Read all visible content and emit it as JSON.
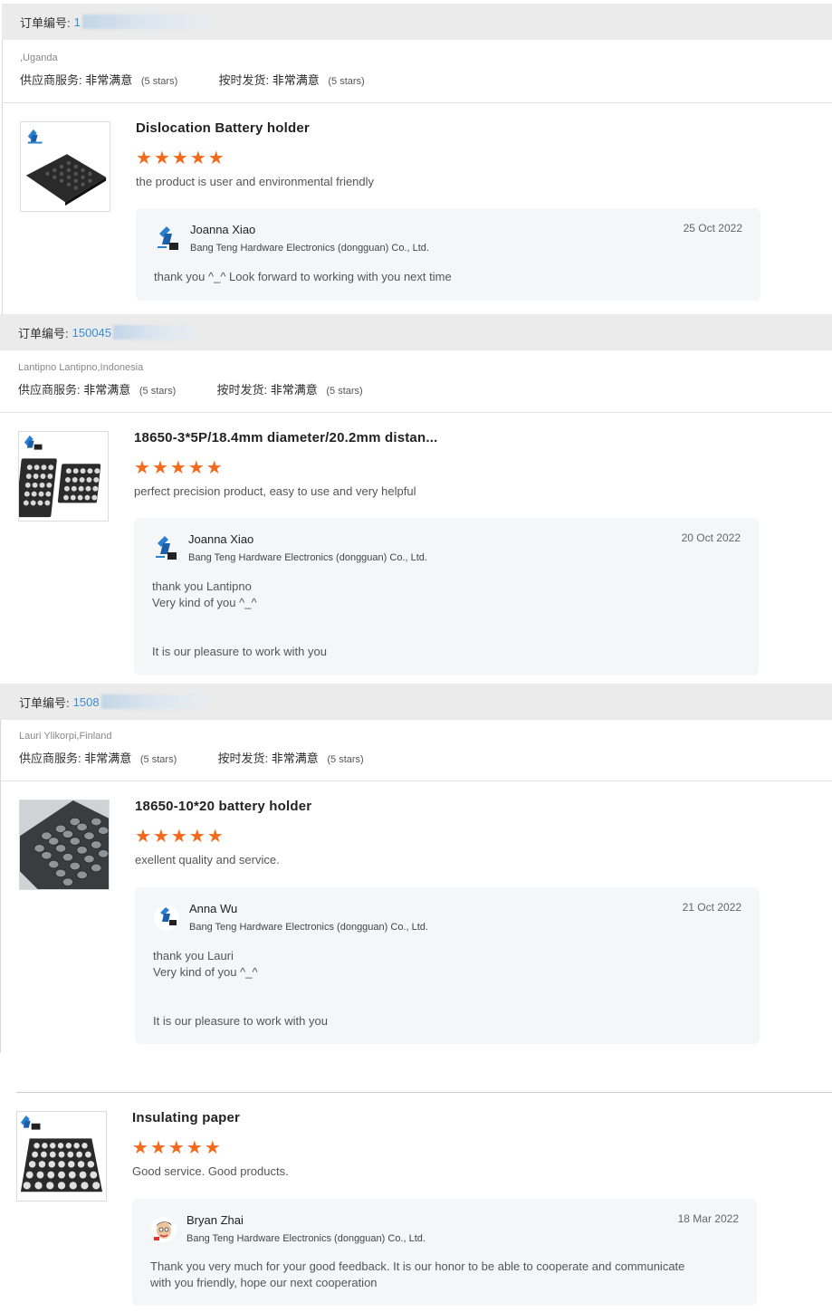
{
  "orders": [
    {
      "order_label": "订单编号:",
      "order_number": "1",
      "buyer_location": ",Uganda",
      "supplier_service_label": "供应商服务:",
      "supplier_service_value": "非常满意",
      "supplier_service_stars": "(5 stars)",
      "shipping_label": "按时发货:",
      "shipping_value": "非常满意",
      "shipping_stars": "(5 stars)",
      "product_title": "Dislocation Battery holder",
      "rating": 5,
      "review_text": "the product is user and environmental friendly",
      "reply": {
        "name": "Joanna Xiao",
        "company": "Bang Teng Hardware Electronics (dongguan) Co., Ltd.",
        "date": "25 Oct 2022",
        "lines": [
          "thank you  ^_^ Look forward to working with you next time"
        ]
      }
    },
    {
      "order_label": "订单编号:",
      "order_number": "150045",
      "buyer_location": "Lantipno Lantipno,Indonesia",
      "supplier_service_label": "供应商服务:",
      "supplier_service_value": "非常满意",
      "supplier_service_stars": "(5 stars)",
      "shipping_label": "按时发货:",
      "shipping_value": "非常满意",
      "shipping_stars": "(5 stars)",
      "product_title": "18650-3*5P/18.4mm diameter/20.2mm distan...",
      "rating": 5,
      "review_text": "perfect precision product, easy to use and very helpful",
      "reply": {
        "name": "Joanna Xiao",
        "company": "Bang Teng Hardware Electronics (dongguan) Co., Ltd.",
        "date": "20 Oct 2022",
        "lines": [
          "thank you Lantipno",
          "Very kind of you ^_^",
          "",
          "It is our pleasure to work with you"
        ]
      }
    },
    {
      "order_label": "订单编号:",
      "order_number": "1508",
      "buyer_location": "Lauri Ylikorpi,Finland",
      "supplier_service_label": "供应商服务:",
      "supplier_service_value": "非常满意",
      "supplier_service_stars": "(5 stars)",
      "shipping_label": "按时发货:",
      "shipping_value": "非常满意",
      "shipping_stars": "(5 stars)",
      "product_title": "18650-10*20 battery holder",
      "rating": 5,
      "review_text": "exellent quality and service.",
      "reply": {
        "name": "Anna Wu",
        "company": "Bang Teng Hardware Electronics (dongguan) Co., Ltd.",
        "date": "21 Oct 2022",
        "lines": [
          "thank you Lauri",
          "Very kind of you ^_^",
          "",
          "It is our pleasure to work with you"
        ]
      }
    },
    {
      "product_title": "Insulating paper",
      "rating": 5,
      "review_text": "Good service. Good products.",
      "reply": {
        "name": "Bryan Zhai",
        "company": "Bang Teng Hardware Electronics (dongguan) Co., Ltd.",
        "date": "18 Mar 2022",
        "lines": [
          "Thank you very much for your good feedback. It is our honor to be able to cooperate and communicate",
          "with you friendly, hope our next cooperation"
        ]
      }
    }
  ],
  "star_glyph": "★",
  "star_color": "#f26a1b",
  "order_number_color": "#3a8dd6",
  "icons": [
    "company-logo-icon",
    "person-avatar-icon"
  ]
}
